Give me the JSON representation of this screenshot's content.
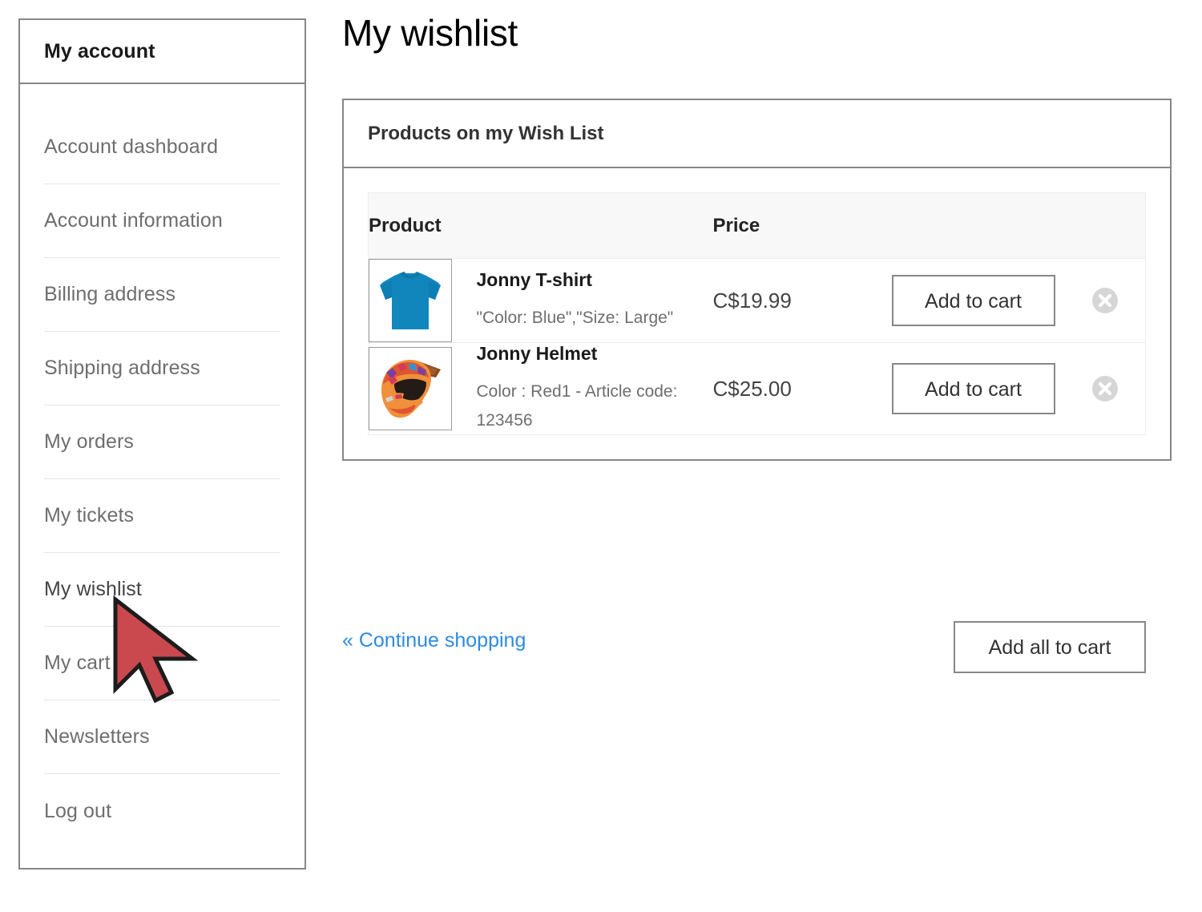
{
  "sidebar": {
    "header_title": "My account",
    "items": [
      {
        "label": "Account dashboard",
        "active": false
      },
      {
        "label": "Account information",
        "active": false
      },
      {
        "label": "Billing address",
        "active": false
      },
      {
        "label": "Shipping address",
        "active": false
      },
      {
        "label": "My orders",
        "active": false
      },
      {
        "label": "My tickets",
        "active": false
      },
      {
        "label": "My wishlist",
        "active": true
      },
      {
        "label": "My cart",
        "active": false
      },
      {
        "label": "Newsletters",
        "active": false
      },
      {
        "label": "Log out",
        "active": false
      }
    ]
  },
  "main": {
    "page_title": "My wishlist",
    "panel_title": "Products on my Wish List",
    "table": {
      "columns": [
        "Product",
        "Price",
        "",
        ""
      ],
      "rows": [
        {
          "thumb": "blue-tshirt-image",
          "name": "Jonny T-shirt",
          "options": "\"Color: Blue\",\"Size: Large\"",
          "price": "C$19.99",
          "add_label": "Add to cart",
          "remove_icon": "remove-circle-x-icon"
        },
        {
          "thumb": "motocross-helmet-image",
          "name": "Jonny Helmet",
          "options": "Color : Red1 - Article code: 123456",
          "price": "C$25.00",
          "add_label": "Add to cart",
          "remove_icon": "remove-circle-x-icon"
        }
      ]
    }
  },
  "footer": {
    "continue_label": "« Continue shopping",
    "add_all_label": "Add all to cart"
  },
  "colors": {
    "link": "#2d8ce0",
    "border": "#878787",
    "muted_text": "#6e6e6e",
    "table_header_bg": "#f8f8f8",
    "cursor_red": "#c9494f"
  },
  "cursor": {
    "icon": "mouse-pointer-arrow"
  }
}
